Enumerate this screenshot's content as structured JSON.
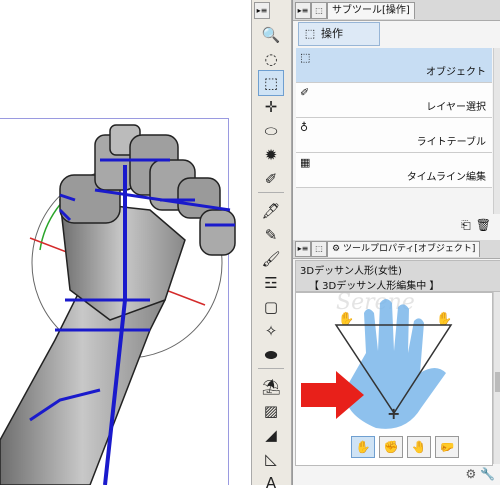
{
  "toolbar": {
    "collapse_btn": "▸≡",
    "tools": [
      {
        "name": "zoom-tool",
        "glyph": "🔍",
        "selected": false
      },
      {
        "name": "move-tool",
        "glyph": "◌",
        "selected": false
      },
      {
        "name": "operation-tool",
        "glyph": "⬚",
        "selected": true
      },
      {
        "name": "move-layer-tool",
        "glyph": "✛",
        "selected": false
      },
      {
        "name": "selection-tool",
        "glyph": "⬭",
        "selected": false
      },
      {
        "name": "auto-select-tool",
        "glyph": "✹",
        "selected": false
      },
      {
        "name": "eyedropper-tool",
        "glyph": "✐",
        "selected": false
      },
      {
        "name": "pen-tool",
        "glyph": "🖋",
        "selected": false
      },
      {
        "name": "pencil-tool",
        "glyph": "✎",
        "selected": false
      },
      {
        "name": "brush-tool",
        "glyph": "🖌",
        "selected": false
      },
      {
        "name": "airbrush-tool",
        "glyph": "☲",
        "selected": false
      },
      {
        "name": "eraser-tool",
        "glyph": "▢",
        "selected": false
      },
      {
        "name": "decoration-tool",
        "glyph": "✧",
        "selected": false
      },
      {
        "name": "blend-tool",
        "glyph": "⬬",
        "selected": false
      },
      {
        "name": "fill-tool",
        "glyph": "⛱",
        "selected": false
      },
      {
        "name": "gradient-tool",
        "glyph": "▨",
        "selected": false
      },
      {
        "name": "figure-tool",
        "glyph": "◢",
        "selected": false
      },
      {
        "name": "ruler-tool",
        "glyph": "◺",
        "selected": false
      },
      {
        "name": "text-tool",
        "glyph": "A",
        "selected": false
      }
    ]
  },
  "subtool": {
    "tab_label": "サブツール[操作]",
    "group_label": "操作",
    "items": [
      {
        "label": "オブジェクト",
        "active": true
      },
      {
        "label": "レイヤー選択",
        "active": false
      },
      {
        "label": "ライトテーブル",
        "active": false
      },
      {
        "label": "タイムライン編集",
        "active": false
      }
    ]
  },
  "tool_property": {
    "tab_label": "ツールプロパティ[オブジェクト]",
    "model_name": "3Dデッサン人形(女性)",
    "status": "【 3Dデッサン人形編集中 】",
    "pose_buttons": [
      "✋",
      "✊",
      "🤚",
      "🤛"
    ],
    "selected_pose": 0
  },
  "colors": {
    "accent_blue": "#1a1acc",
    "arrow_red": "#e8201a",
    "hand_blue": "#7ab6ea",
    "selection": "#cfe3f5"
  }
}
